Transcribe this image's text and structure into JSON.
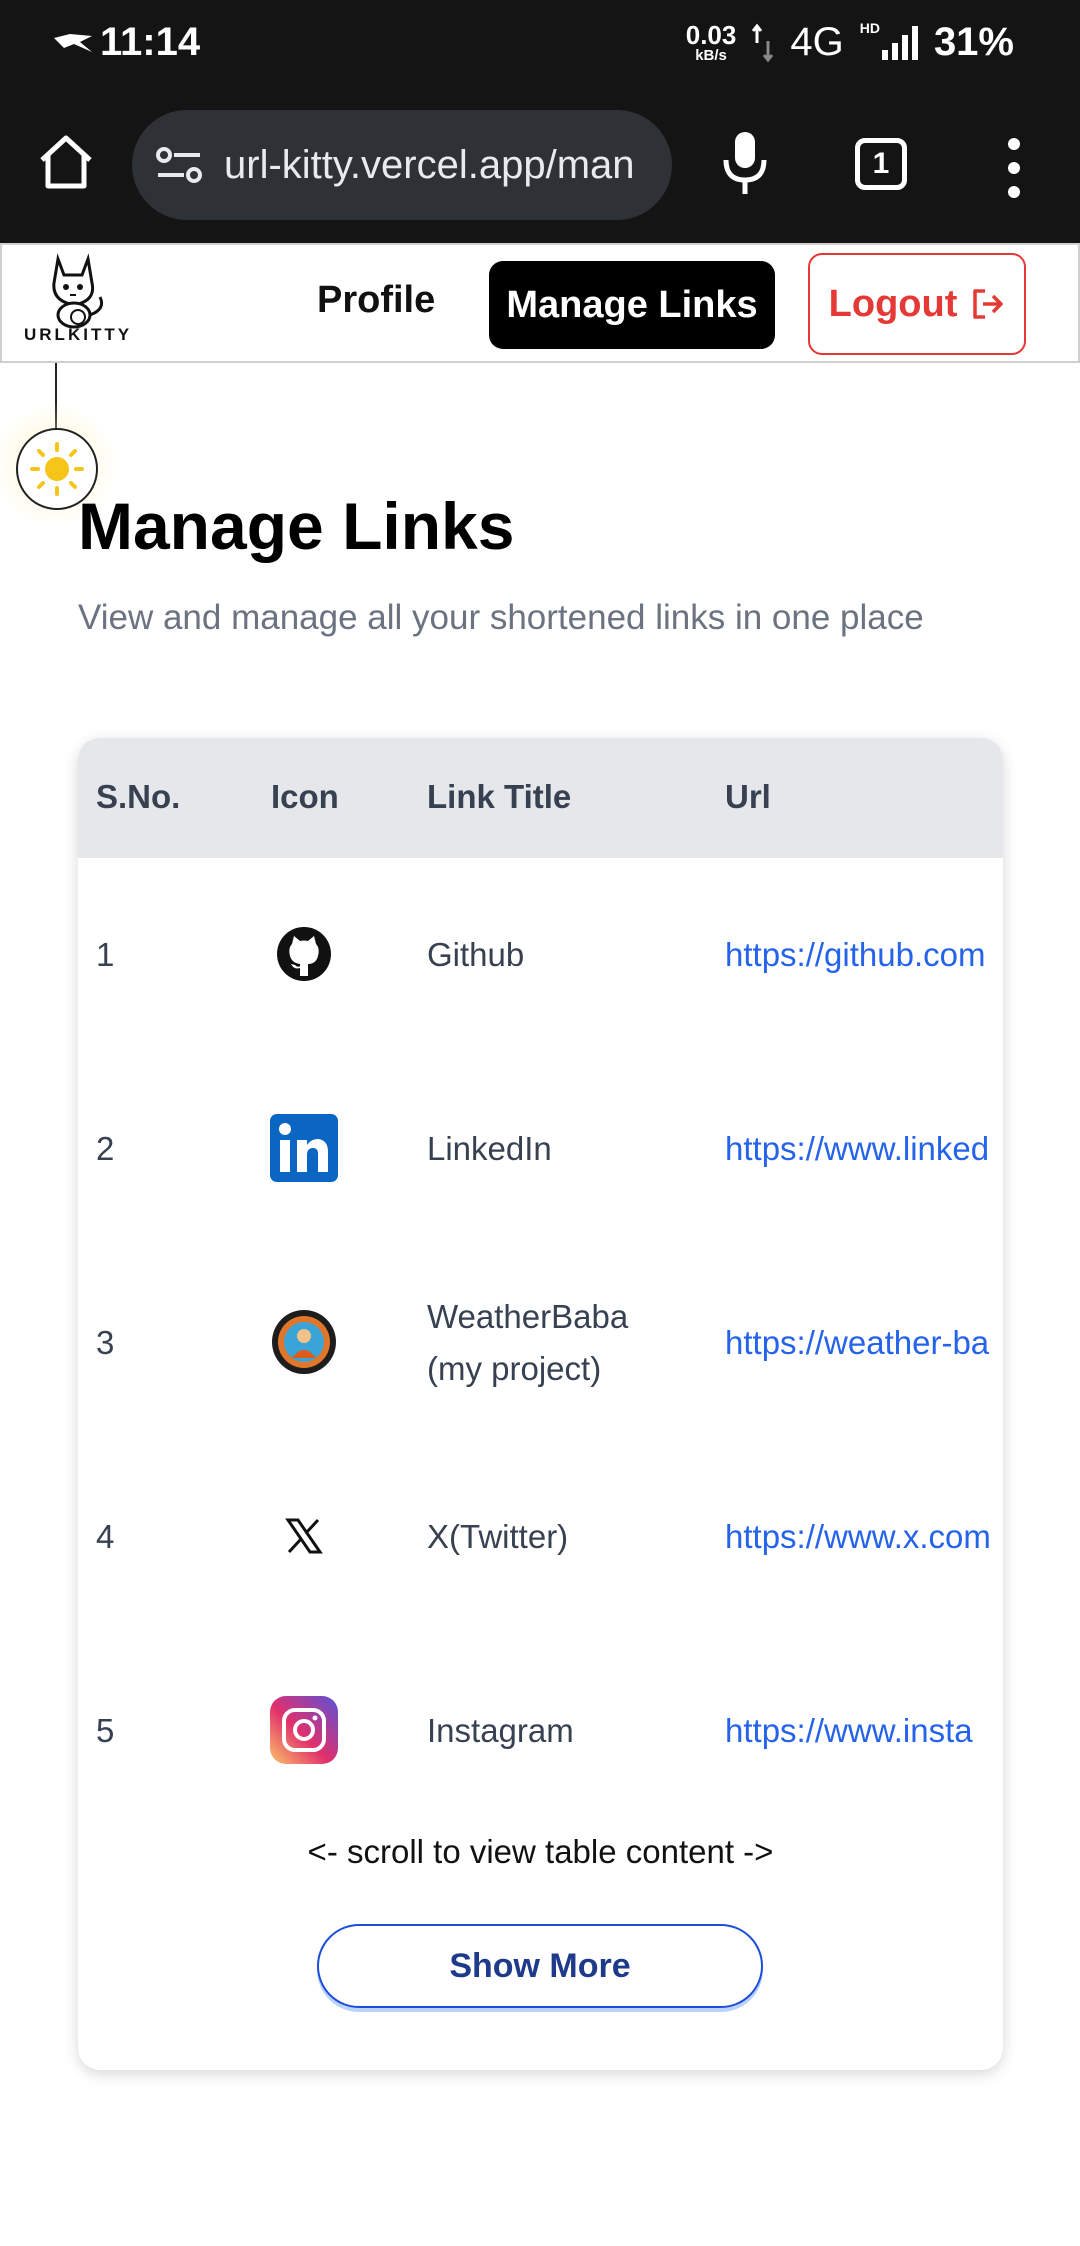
{
  "status_bar": {
    "time": "11:14",
    "net_speed_value": "0.03",
    "net_speed_unit": "kB/s",
    "network": "4G",
    "hd_label": "HD",
    "battery": "31%"
  },
  "browser": {
    "url": "url-kitty.vercel.app/man",
    "tab_count": "1"
  },
  "nav": {
    "logo_text": "URLKITTY",
    "profile": "Profile",
    "manage_links": "Manage Links",
    "logout": "Logout"
  },
  "main": {
    "title": "Manage Links",
    "subtitle": "View and manage all your shortened links in one place"
  },
  "table": {
    "headers": [
      "S.No.",
      "Icon",
      "Link Title",
      "Url"
    ],
    "rows": [
      {
        "sno": "1",
        "icon": "github-icon",
        "title": "Github",
        "title2": "",
        "url": "https://github.com"
      },
      {
        "sno": "2",
        "icon": "linkedin-icon",
        "title": "LinkedIn",
        "title2": "",
        "url": "https://www.linked"
      },
      {
        "sno": "3",
        "icon": "weatherbaba-icon",
        "title": "WeatherBaba",
        "title2": "(my project)",
        "url": "https://weather-ba"
      },
      {
        "sno": "4",
        "icon": "x-twitter-icon",
        "title": "X(Twitter)",
        "title2": "",
        "url": "https://www.x.com"
      },
      {
        "sno": "5",
        "icon": "instagram-icon",
        "title": "Instagram",
        "title2": "",
        "url": "https://www.insta"
      }
    ],
    "scroll_hint": "<- scroll to view table content ->",
    "show_more": "Show More"
  },
  "colors": {
    "accent": "#2563eb",
    "logout": "#e53935",
    "header_bg": "#e5e7eb",
    "browser_bg": "#141414"
  }
}
